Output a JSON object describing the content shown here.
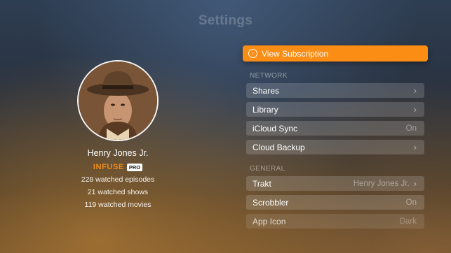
{
  "header": {
    "title": "Settings"
  },
  "profile": {
    "name": "Henry Jones Jr.",
    "brand": "INFUSE",
    "badge": "PRO",
    "stats": [
      "228 watched episodes",
      "21 watched shows",
      "119 watched movies"
    ]
  },
  "subscription": {
    "label": "View Subscription",
    "icon": "subscription-icon"
  },
  "network": {
    "header": "NETWORK",
    "rows": [
      {
        "label": "Shares",
        "value": "",
        "chevron": true
      },
      {
        "label": "Library",
        "value": "",
        "chevron": true
      },
      {
        "label": "iCloud Sync",
        "value": "On",
        "chevron": false
      },
      {
        "label": "Cloud Backup",
        "value": "",
        "chevron": true
      }
    ]
  },
  "general": {
    "header": "GENERAL",
    "rows": [
      {
        "label": "Trakt",
        "value": "Henry Jones Jr.",
        "chevron": true
      },
      {
        "label": "Scrobbler",
        "value": "On",
        "chevron": false
      },
      {
        "label": "App Icon",
        "value": "Dark",
        "chevron": false
      }
    ]
  },
  "colors": {
    "accent": "#fb8c14",
    "brand": "#f08a1a"
  }
}
